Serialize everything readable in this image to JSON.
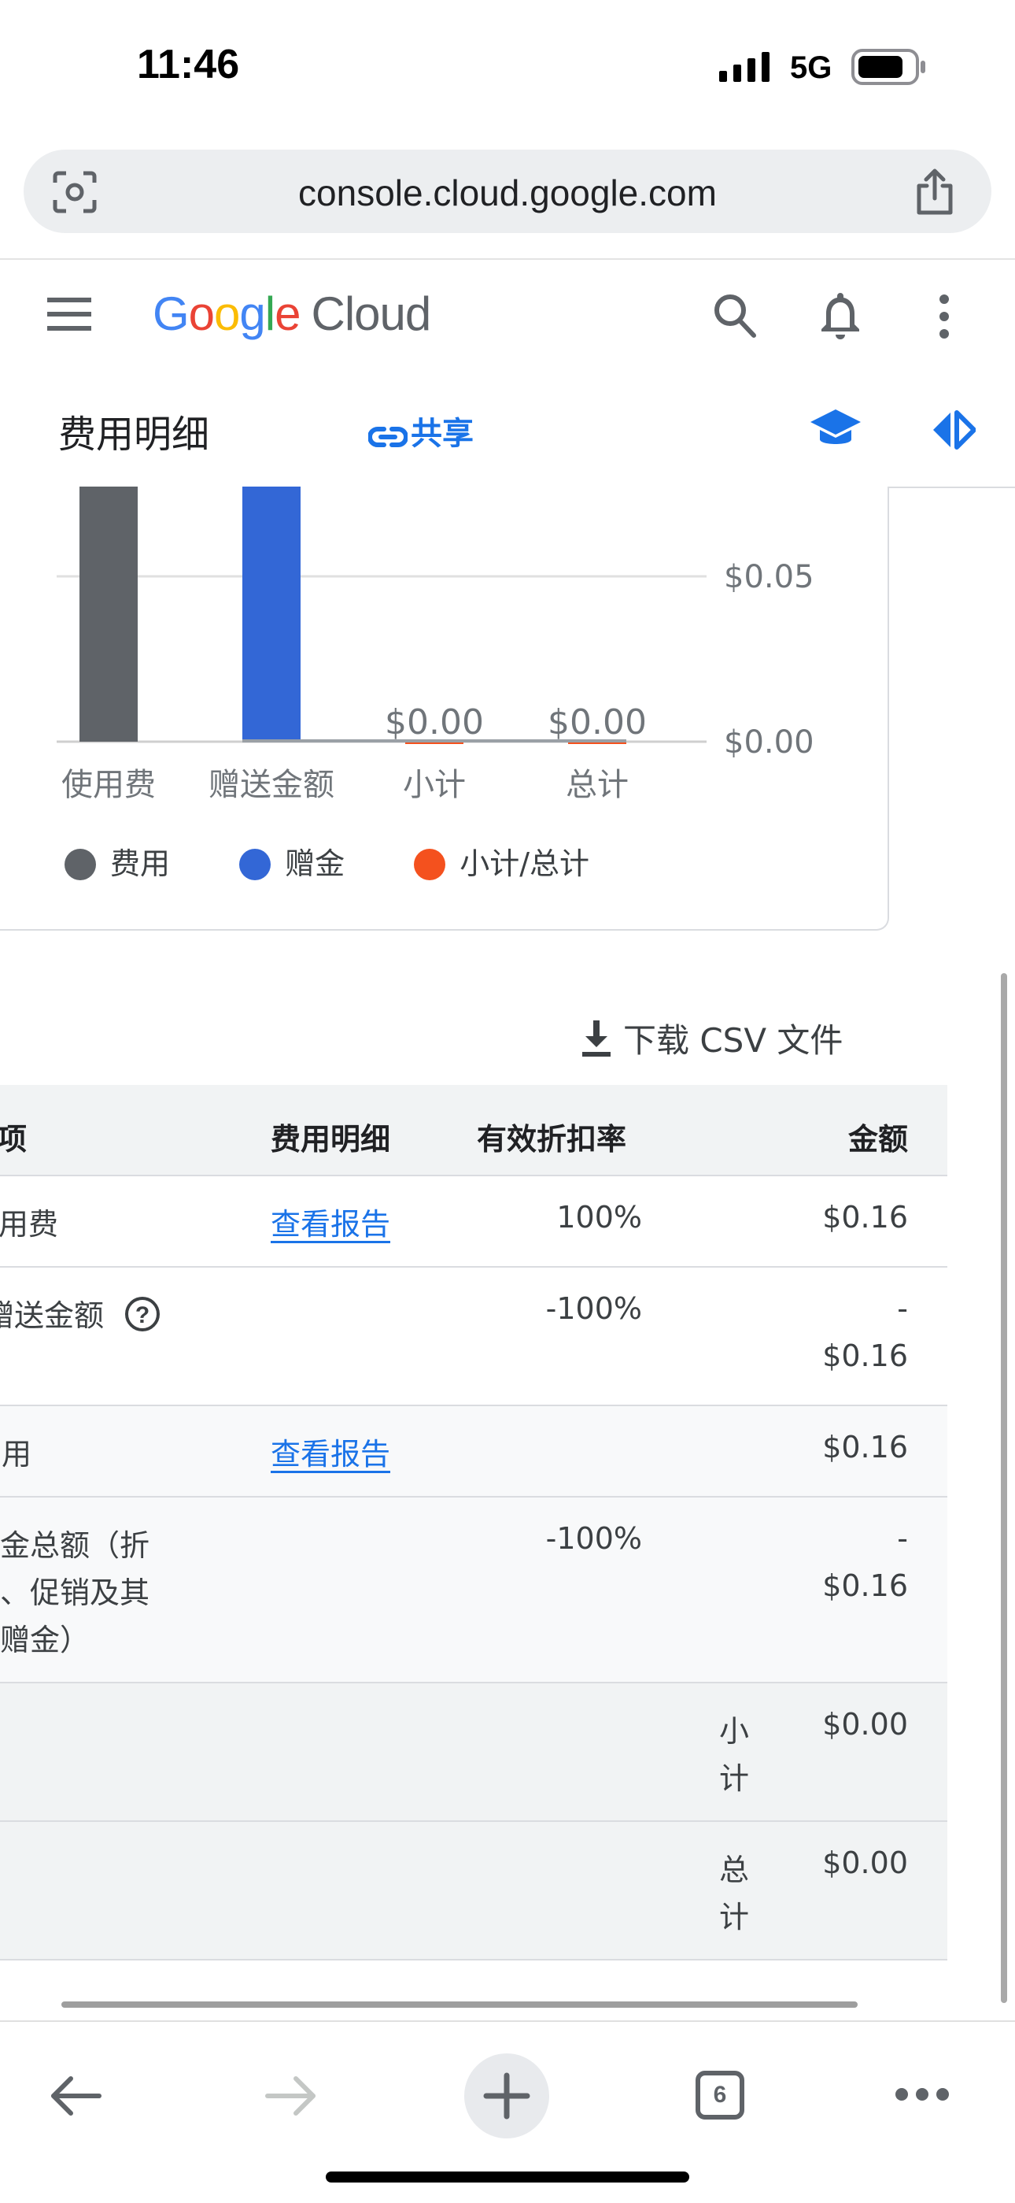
{
  "status_bar": {
    "time": "11:46",
    "network": "5G"
  },
  "browser": {
    "url": "console.cloud.google.com"
  },
  "header": {
    "logo_google": [
      "G",
      "o",
      "o",
      "g",
      "l",
      "e"
    ],
    "logo_colors": [
      "#4285F4",
      "#EA4335",
      "#FBBC05",
      "#4285F4",
      "#34A853",
      "#EA4335"
    ],
    "logo_cloud": "Cloud"
  },
  "page": {
    "title": "费用明细",
    "share_label": "共享"
  },
  "chart_data": {
    "type": "bar",
    "categories": [
      "使用费",
      "赠送金额",
      "小计",
      "总计"
    ],
    "values": [
      0.16,
      -0.16,
      0.0,
      0.0
    ],
    "data_labels": [
      "",
      "",
      "$0.00",
      "$0.00"
    ],
    "y_ticks": [
      "$0.05",
      "$0.00"
    ],
    "colors": [
      "#5f6368",
      "#3367d6",
      "#f4511e",
      "#f4511e"
    ],
    "legend": [
      {
        "label": "费用",
        "color": "#5f6368"
      },
      {
        "label": "赠金",
        "color": "#3367d6"
      },
      {
        "label": "小计/总计",
        "color": "#f4511e"
      }
    ],
    "legend_position": "bottom",
    "grid": true
  },
  "download_label": "下载 CSV 文件",
  "table": {
    "headers": {
      "item": "细项",
      "details": "费用明细",
      "rate": "有效折扣率",
      "amount": "金额"
    },
    "rows": [
      {
        "item": "使用费",
        "details": "查看报告",
        "rate": "100%",
        "amount_line1": "",
        "amount_line2": "$0.16"
      },
      {
        "item": "赠送金额",
        "details": "",
        "rate": "-100%",
        "amount_line1": "-",
        "amount_line2": "$0.16"
      },
      {
        "item": "费用",
        "details": "查看报告",
        "rate": "",
        "amount_line1": "",
        "amount_line2": "$0.16"
      },
      {
        "item_lines": [
          "赠金总额（折",
          "扣、促销及其",
          "他赠金）"
        ],
        "details": "",
        "rate": "-100%",
        "amount_line1": "-",
        "amount_line2": "$0.16"
      }
    ],
    "subtotal": {
      "label_lines": [
        "小",
        "计"
      ],
      "amount": "$0.00"
    },
    "total": {
      "label_lines": [
        "总",
        "计"
      ],
      "amount": "$0.00"
    }
  },
  "toolbar": {
    "tab_count": "6"
  }
}
